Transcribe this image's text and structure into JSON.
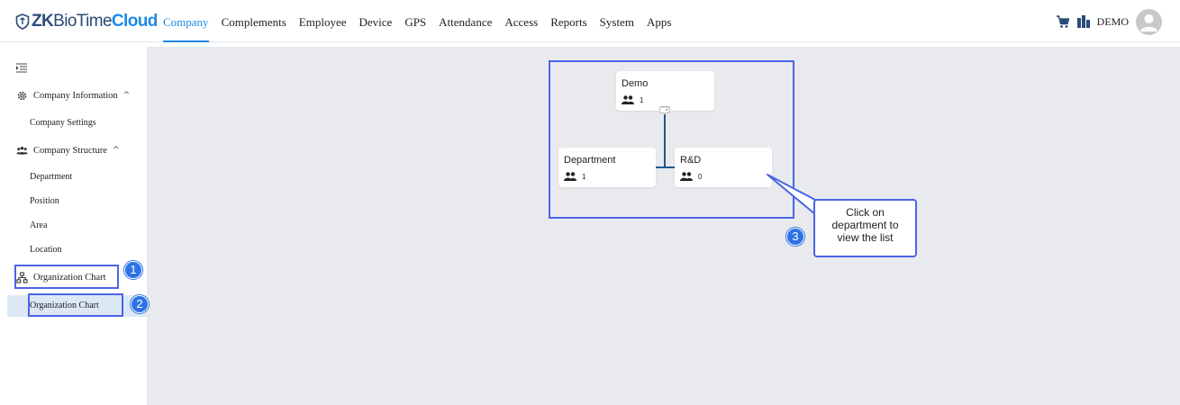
{
  "brand": {
    "logo_part1": "ZK",
    "logo_part2": "BioTime",
    "logo_part3": "Cloud"
  },
  "nav": {
    "items": [
      {
        "label": "Company",
        "active": true
      },
      {
        "label": "Complements"
      },
      {
        "label": "Employee"
      },
      {
        "label": "Device"
      },
      {
        "label": "GPS"
      },
      {
        "label": "Attendance"
      },
      {
        "label": "Access"
      },
      {
        "label": "Reports"
      },
      {
        "label": "System"
      },
      {
        "label": "Apps"
      }
    ],
    "user_label": "DEMO"
  },
  "sidebar": {
    "sections": [
      {
        "label": "Company Information",
        "icon": "gear-icon",
        "caret": "^"
      },
      {
        "label": "Company Settings"
      },
      {
        "label": "Company Structure",
        "icon": "team-icon",
        "caret": "^"
      },
      {
        "label": "Department"
      },
      {
        "label": "Position"
      },
      {
        "label": "Area"
      },
      {
        "label": "Location"
      },
      {
        "label": "Organization Chart",
        "icon": "org-chart-icon"
      },
      {
        "label": "Organization Chart",
        "active": true
      }
    ]
  },
  "org_chart": {
    "root": {
      "name": "Demo",
      "count": "1",
      "expand_label": "^2"
    },
    "children": [
      {
        "name": "Department",
        "count": "1"
      },
      {
        "name": "R&D",
        "count": "0"
      }
    ]
  },
  "annotations": {
    "badges": [
      "1",
      "2",
      "3"
    ],
    "callout_lines": [
      "Click on",
      "department to",
      "view the list"
    ]
  },
  "colors": {
    "accent": "#1e88e5",
    "highlight": "#4a64e6",
    "badge": "#2f72e4",
    "canvas": "#e8eaee"
  }
}
